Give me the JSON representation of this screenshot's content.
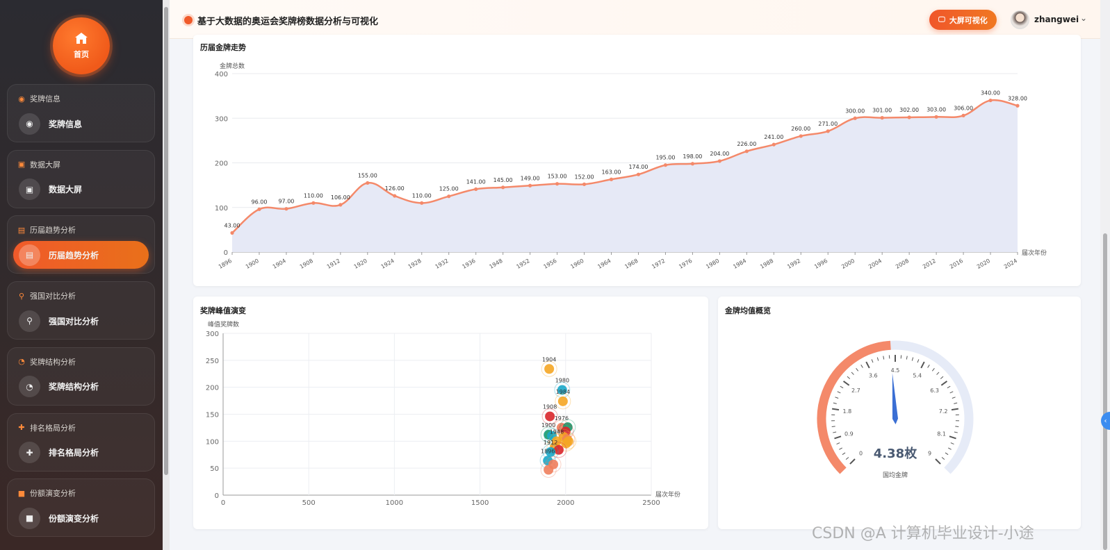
{
  "sidebar": {
    "home_label": "首页",
    "groups": [
      {
        "title": "奖牌信息",
        "icon": "medal-icon",
        "item": "奖牌信息",
        "active": false
      },
      {
        "title": "数据大屏",
        "icon": "screen-icon",
        "item": "数据大屏",
        "active": false
      },
      {
        "title": "历届趋势分析",
        "icon": "trend-icon",
        "item": "历届趋势分析",
        "active": true
      },
      {
        "title": "强国对比分析",
        "icon": "trophy-icon",
        "item": "强国对比分析",
        "active": false
      },
      {
        "title": "奖牌结构分析",
        "icon": "clock-icon",
        "item": "奖牌结构分析",
        "active": false
      },
      {
        "title": "排名格局分析",
        "icon": "move-icon",
        "item": "排名格局分析",
        "active": false
      },
      {
        "title": "份额演变分析",
        "icon": "square-icon",
        "item": "份额演变分析",
        "active": false
      }
    ]
  },
  "header": {
    "title": "基于大数据的奥运会奖牌榜数据分析与可视化",
    "big_screen_label": "大屏可视化",
    "username": "zhangwei"
  },
  "cards": {
    "trend_title": "历届金牌走势",
    "scatter_title": "奖牌峰值演变",
    "gauge_title": "金牌均值概览"
  },
  "chart_data": [
    {
      "type": "line",
      "title": "历届金牌走势",
      "ylabel": "金牌总数",
      "xlabel": "届次年份",
      "ylim": [
        0,
        400
      ],
      "yticks": [
        0,
        100,
        200,
        300,
        400
      ],
      "area": true,
      "color": "#f4896a",
      "x": [
        "1896",
        "1900",
        "1904",
        "1908",
        "1912",
        "1920",
        "1924",
        "1928",
        "1932",
        "1936",
        "1948",
        "1952",
        "1956",
        "1960",
        "1964",
        "1968",
        "1972",
        "1976",
        "1980",
        "1984",
        "1988",
        "1992",
        "1996",
        "2000",
        "2004",
        "2008",
        "2012",
        "2016",
        "2020",
        "2024"
      ],
      "values": [
        43,
        96,
        97,
        110,
        106,
        155,
        126,
        110,
        125,
        141,
        145,
        149,
        153,
        152,
        163,
        174,
        195,
        198,
        204,
        226,
        241,
        260,
        271,
        300,
        301,
        302,
        303,
        306,
        340,
        328
      ],
      "value_labels": [
        "43.00",
        "96.00",
        "97.00",
        "110.00",
        "106.00",
        "155.00",
        "126.00",
        "110.00",
        "125.00",
        "141.00",
        "145.00",
        "149.00",
        "153.00",
        "152.00",
        "163.00",
        "174.00",
        "195.00",
        "198.00",
        "204.00",
        "226.00",
        "241.00",
        "260.00",
        "271.00",
        "300.00",
        "301.00",
        "302.00",
        "303.00",
        "306.00",
        "340.00",
        "328.00"
      ]
    },
    {
      "type": "scatter",
      "title": "奖牌峰值演变",
      "ylabel": "峰值奖牌数",
      "xlabel": "届次年份",
      "xlim": [
        0,
        2500
      ],
      "ylim": [
        0,
        300
      ],
      "xticks": [
        0,
        500,
        1000,
        1500,
        2000,
        2500
      ],
      "yticks": [
        0,
        50,
        100,
        150,
        200,
        250,
        300
      ],
      "points": [
        {
          "x": 1904,
          "y": 234,
          "label": "1904",
          "color": "#f5a623"
        },
        {
          "x": 1980,
          "y": 195,
          "label": "1980",
          "color": "#1aa9c9"
        },
        {
          "x": 1984,
          "y": 174,
          "label": "1984",
          "color": "#f5a623"
        },
        {
          "x": 1908,
          "y": 146,
          "label": "1908",
          "color": "#d9262b"
        },
        {
          "x": 1900,
          "y": 112,
          "label": "1900",
          "color": "#179a6c"
        },
        {
          "x": 1976,
          "y": 125,
          "label": "1976",
          "color": "#f07e5c"
        },
        {
          "x": 2012,
          "y": 126,
          "label": "",
          "color": "#179a6c"
        },
        {
          "x": 2000,
          "y": 118,
          "label": "",
          "color": "#d9262b"
        },
        {
          "x": 1920,
          "y": 110,
          "label": "",
          "color": "#1aa9c9"
        },
        {
          "x": 1988,
          "y": 108,
          "label": "",
          "color": "#f5a623"
        },
        {
          "x": 2008,
          "y": 104,
          "label": "",
          "color": "#f07e5c"
        },
        {
          "x": 2016,
          "y": 100,
          "label": "",
          "color": "#f5a623"
        },
        {
          "x": 1948,
          "y": 100,
          "label": "1948",
          "color": "#f5a623"
        },
        {
          "x": 2004,
          "y": 96,
          "label": "",
          "color": "#f5a623"
        },
        {
          "x": 1936,
          "y": 89,
          "label": "",
          "color": "#f5a623"
        },
        {
          "x": 1960,
          "y": 84,
          "label": "",
          "color": "#d9262b"
        },
        {
          "x": 1912,
          "y": 80,
          "label": "1912",
          "color": "#1aa9c9"
        },
        {
          "x": 1896,
          "y": 64,
          "label": "1896",
          "color": "#1aa9c9"
        },
        {
          "x": 1928,
          "y": 57,
          "label": "",
          "color": "#f07e5c"
        },
        {
          "x": 1900,
          "y": 47,
          "label": "",
          "color": "#f07e5c"
        }
      ]
    },
    {
      "type": "gauge",
      "title": "金牌均值概览",
      "min": 0,
      "max": 9,
      "value": 4.38,
      "ticks": [
        "0",
        "0.9",
        "1.8",
        "2.7",
        "3.6",
        "4.5",
        "5.4",
        "6.3",
        "7.2",
        "8.1",
        "9"
      ],
      "value_text": "4.38枚",
      "detail": "国均金牌",
      "progress_color": "#f4896a",
      "track_color": "#e6ebf7",
      "pointer_color": "#3b6fd4"
    }
  ],
  "watermark": "CSDN @A 计算机毕业设计-小途"
}
